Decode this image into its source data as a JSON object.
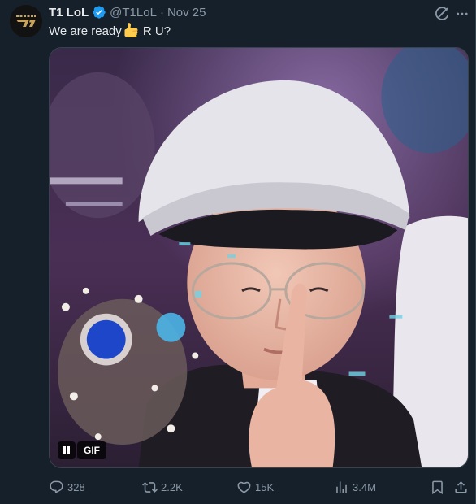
{
  "author": {
    "display_name": "T1 LoL",
    "handle": "@T1LoL",
    "separator": "·",
    "timestamp": "Nov 25",
    "verified": true
  },
  "tweet": {
    "text_before_emoji": "We are ready",
    "emoji": "thumbs-up",
    "text_after_emoji": " R U?"
  },
  "media": {
    "type": "gif",
    "badge_label": "GIF",
    "state": "playing"
  },
  "actions": {
    "replies": "328",
    "reposts": "2.2K",
    "likes": "15K",
    "views": "3.4M"
  },
  "colors": {
    "background": "#15202b",
    "text_primary": "#e7e9ea",
    "text_secondary": "#8b98a5",
    "verified_blue": "#1d9bf0",
    "brand_gold": "#c8a45c"
  },
  "icons": [
    "t1-logo",
    "verified-badge-icon",
    "grok-icon",
    "more-icon",
    "pause-icon",
    "reply-icon",
    "repost-icon",
    "like-icon",
    "views-icon",
    "bookmark-icon",
    "share-icon"
  ]
}
